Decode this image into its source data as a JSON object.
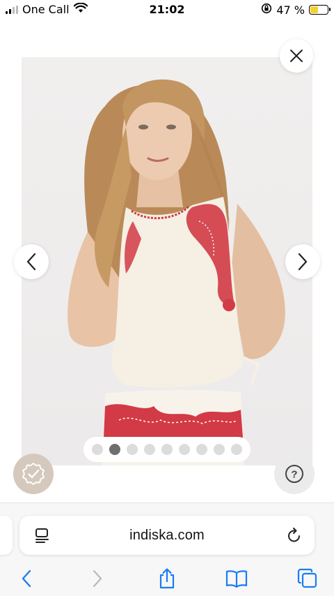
{
  "status_bar": {
    "carrier": "One Call",
    "time": "21:02",
    "battery_percent": "47 %",
    "battery_level": 0.47,
    "icons": [
      "signal-icon",
      "wifi-icon",
      "orientation-lock-icon",
      "battery-charging-icon"
    ]
  },
  "gallery": {
    "image_count": 9,
    "active_index": 1,
    "icons": [
      "close-icon",
      "chevron-left-icon",
      "chevron-right-icon"
    ]
  },
  "floating_buttons": {
    "icons": [
      "verified-badge-icon",
      "help-icon"
    ],
    "help_glyph": "?"
  },
  "browser": {
    "url": "indiska.com",
    "icons": [
      "reader-icon",
      "reload-icon",
      "back-icon",
      "forward-icon",
      "share-icon",
      "bookmarks-icon",
      "tabs-icon"
    ]
  },
  "colors": {
    "accent": "#1a7cf3",
    "disabled": "#b9b9b9",
    "embroidery": "#d23a45",
    "top": "#f5efe4"
  }
}
